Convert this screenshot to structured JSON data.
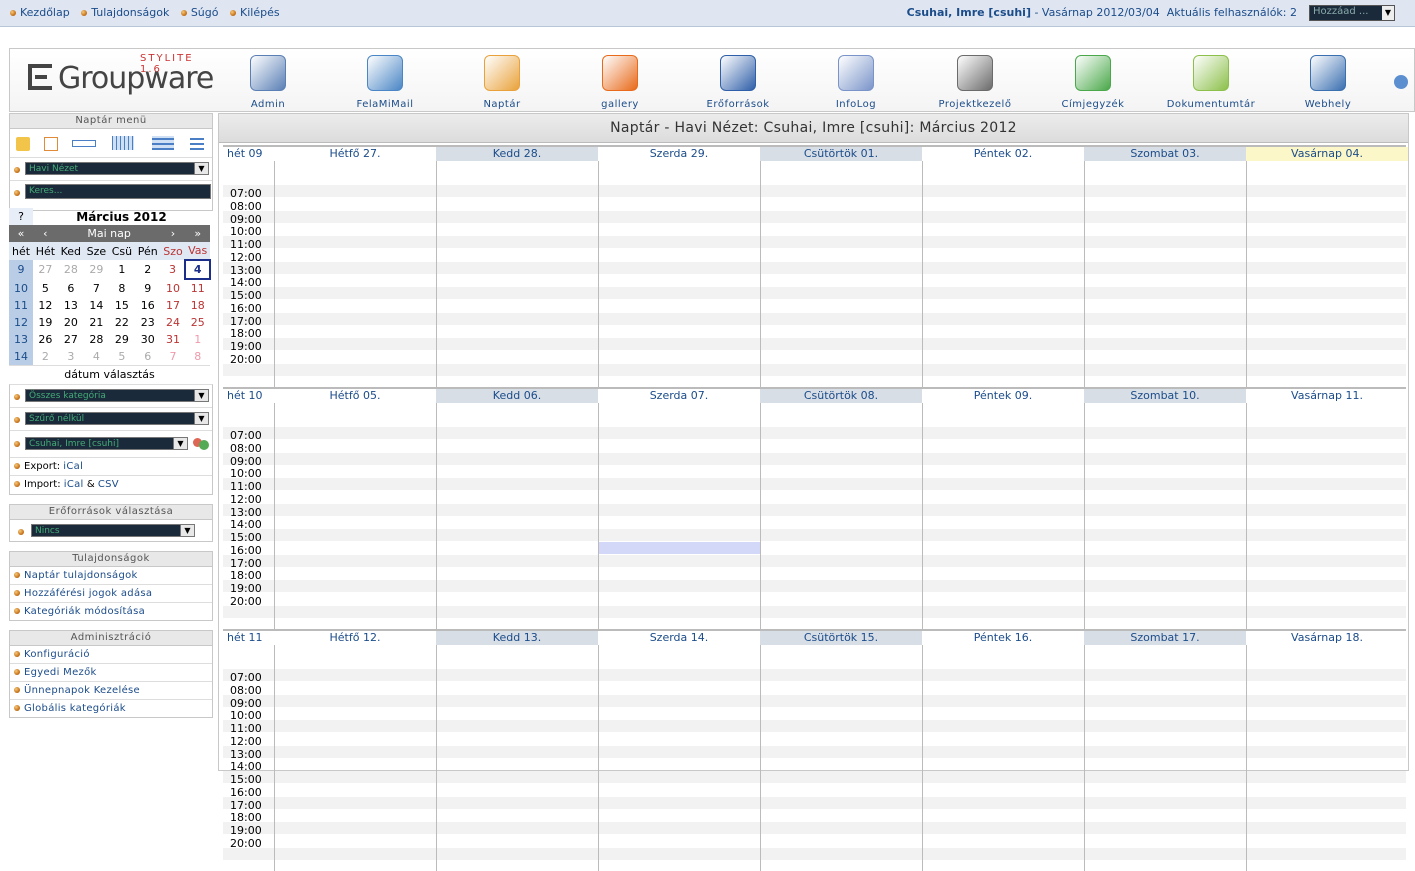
{
  "topbar": {
    "links": [
      "Kezdőlap",
      "Tulajdonságok",
      "Súgó",
      "Kilépés"
    ],
    "user": "Csuhai, Imre [csuhi]",
    "date_text": " - Vasárnap 2012/03/04",
    "online": "Aktuális felhasználók: 2",
    "add_select": "Hozzáad ..."
  },
  "header": {
    "logo_version": "STYLITE 1.6",
    "logo_name": "Groupware",
    "apps": [
      {
        "label": "Admin",
        "icon": "admin-icon",
        "color": "#5a7fb5"
      },
      {
        "label": "FelaMiMail",
        "icon": "mail-icon",
        "color": "#4a86c5"
      },
      {
        "label": "Naptár",
        "icon": "calendar-icon",
        "color": "#e9a23b"
      },
      {
        "label": "gallery",
        "icon": "gallery-icon",
        "color": "#e86a1a"
      },
      {
        "label": "Erőforrások",
        "icon": "resources-icon",
        "color": "#2f5fa8"
      },
      {
        "label": "InfoLog",
        "icon": "infolog-icon",
        "color": "#7a94c9"
      },
      {
        "label": "Projektkezelő",
        "icon": "project-icon",
        "color": "#6b6b6b"
      },
      {
        "label": "Címjegyzék",
        "icon": "addressbook-icon",
        "color": "#4aa84a"
      },
      {
        "label": "Dokumentumtár",
        "icon": "filemanager-icon",
        "color": "#8cc04a"
      },
      {
        "label": "Webhely",
        "icon": "website-icon",
        "color": "#3a6fb0"
      }
    ]
  },
  "sidebar": {
    "menu_title": "Naptár menü",
    "view_select": "Havi Nézet",
    "search_placeholder": "Keres...",
    "minical": {
      "help": "?",
      "month": "Március 2012",
      "today": "Mai nap",
      "nav": [
        "«",
        "‹",
        "›",
        "»"
      ],
      "week_label": "hét",
      "days": [
        "Hét",
        "Ked",
        "Sze",
        "Csü",
        "Pén",
        "Szo",
        "Vas"
      ],
      "weeks": [
        {
          "wk": "9",
          "d": [
            "27",
            "28",
            "29",
            "1",
            "2",
            "3",
            "4"
          ]
        },
        {
          "wk": "10",
          "d": [
            "5",
            "6",
            "7",
            "8",
            "9",
            "10",
            "11"
          ]
        },
        {
          "wk": "11",
          "d": [
            "12",
            "13",
            "14",
            "15",
            "16",
            "17",
            "18"
          ]
        },
        {
          "wk": "12",
          "d": [
            "19",
            "20",
            "21",
            "22",
            "23",
            "24",
            "25"
          ]
        },
        {
          "wk": "13",
          "d": [
            "26",
            "27",
            "28",
            "29",
            "30",
            "31",
            "1"
          ]
        },
        {
          "wk": "14",
          "d": [
            "2",
            "3",
            "4",
            "5",
            "6",
            "7",
            "8"
          ]
        }
      ],
      "date_choice": "dátum választás"
    },
    "category_select": "Összes kategória",
    "filter_select": "Szűrő nélkül",
    "user_select": "Csuhai, Imre [csuhi]",
    "export_label": "Export:",
    "export_ical": "iCal",
    "import_label": "Import:",
    "import_ical": "iCal",
    "import_amp": "&",
    "import_csv": "CSV",
    "resources_title": "Erőforrások választása",
    "resources_select": "Nincs",
    "prefs_title": "Tulajdonságok",
    "prefs_links": [
      "Naptár tulajdonságok",
      "Hozzáférési jogok adása",
      "Kategóriák módosítása"
    ],
    "admin_title": "Adminisztráció",
    "admin_links": [
      "Konfiguráció",
      "Egyedi Mezők",
      "Ünnepnapok Kezelése",
      "Globális kategóriák"
    ]
  },
  "main": {
    "title": "Naptár - Havi Nézet: Csuhai, Imre [csuhi]: Március 2012",
    "hours": [
      "07:00",
      "08:00",
      "09:00",
      "10:00",
      "11:00",
      "12:00",
      "13:00",
      "14:00",
      "15:00",
      "16:00",
      "17:00",
      "18:00",
      "19:00",
      "20:00"
    ],
    "weeks": [
      {
        "label": "hét 09",
        "days": [
          "Hétfő 27.",
          "Kedd 28.",
          "Szerda 29.",
          "Csütörtök 01.",
          "Péntek 02.",
          "Szombat 03.",
          "Vasárnap 04."
        ]
      },
      {
        "label": "hét 10",
        "days": [
          "Hétfő 05.",
          "Kedd 06.",
          "Szerda 07.",
          "Csütörtök 08.",
          "Péntek 09.",
          "Szombat 10.",
          "Vasárnap 11."
        ]
      },
      {
        "label": "hét 11",
        "days": [
          "Hétfő 12.",
          "Kedd 13.",
          "Szerda 14.",
          "Csütörtök 15.",
          "Péntek 16.",
          "Szombat 17.",
          "Vasárnap 18."
        ]
      }
    ]
  },
  "colors": {
    "link": "#1b4c8a",
    "today_header": "#fbf7c8",
    "alt_header": "#d8dee6",
    "highlight_slot": "#d4d8f8"
  }
}
